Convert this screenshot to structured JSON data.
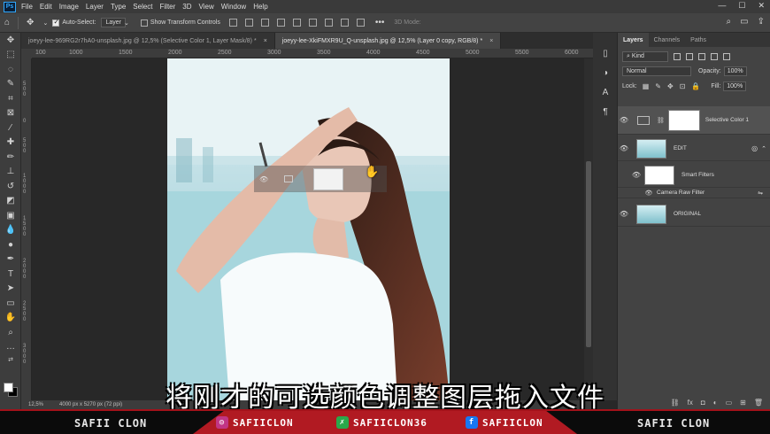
{
  "menubar": {
    "logo": "Ps",
    "items": [
      "File",
      "Edit",
      "Image",
      "Layer",
      "Type",
      "Select",
      "Filter",
      "3D",
      "View",
      "Window",
      "Help"
    ]
  },
  "options": {
    "auto_select_label": "Auto-Select:",
    "auto_select_value": "Layer",
    "transform_label": "Show Transform Controls",
    "mode_3d_label": "3D Mode:"
  },
  "tabs": [
    {
      "label": "joeyy-lee-969RG2r7hA0-unsplash.jpg @ 12,5% (Selective Color 1, Layer Mask/8) *",
      "active": false
    },
    {
      "label": "joeyy-lee-XkiFMXR9U_Q-unsplash.jpg @ 12,5% (Layer 0 copy, RGB/8) *",
      "active": true
    }
  ],
  "ruler_top": [
    "100",
    "1000",
    "1500",
    "2000",
    "2500",
    "3000",
    "3500",
    "4000",
    "4500",
    "5000",
    "5500",
    "6000"
  ],
  "ruler_left": [
    "5 0 0",
    "0",
    "5 0 0",
    "1 0 0 0",
    "1 5 0 0",
    "2 0 0 0",
    "2 5 0 0",
    "3 0 0 0"
  ],
  "status": {
    "zoom": "12,5%",
    "dims": "4000 px x 5270 px (72 ppi)"
  },
  "panel": {
    "tabs": [
      "Layers",
      "Channels",
      "Paths"
    ],
    "kind_label": "Kind",
    "blend_mode": "Normal",
    "opacity_label": "Opacity:",
    "opacity_value": "100%",
    "lock_label": "Lock:",
    "fill_label": "Fill:",
    "fill_value": "100%"
  },
  "layers": [
    {
      "name": "Selective Color 1"
    },
    {
      "name": "EDIT"
    },
    {
      "name": "Smart Filters"
    },
    {
      "name": "Camera Raw Filter"
    },
    {
      "name": "ORIGINAL"
    }
  ],
  "subtitle": "将刚才的可选颜色调整图层拖入文件",
  "banner": {
    "left_name": "SAFII CLON",
    "right_name": "SAFII CLON",
    "instagram": "SAFIICLON",
    "xing": "SAFIICLON36",
    "facebook": "SAFIICLON"
  },
  "colors": {
    "accent": "#31a8ff",
    "banner_red": "#b11a22",
    "instagram": "#c13584",
    "xing": "#2aa84a",
    "facebook": "#1877f2"
  }
}
